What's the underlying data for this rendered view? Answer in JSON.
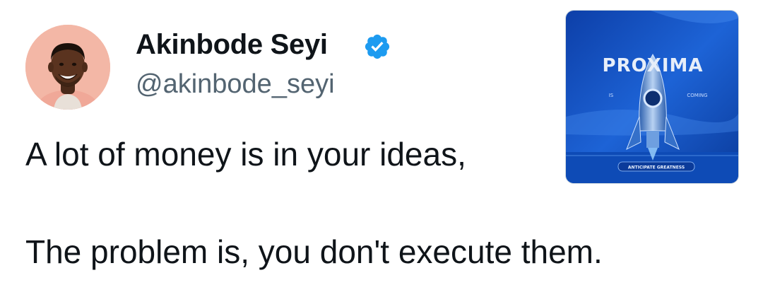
{
  "author": {
    "display_name": "Akinbode Seyi",
    "handle": "@akinbode_seyi",
    "verified": true,
    "avatar_icon": "profile-photo"
  },
  "tweet": {
    "line1": "A lot of money is in your ideas,",
    "line2": "The problem is, you don't execute them."
  },
  "media": {
    "brand": "PROXIMA",
    "tagline": "ANTICIPATE GREATNESS",
    "left_fragment": "IS",
    "right_fragment": "COMING",
    "icon": "rocket-icon"
  },
  "colors": {
    "verified_badge": "#1d9bf0",
    "handle": "#536471",
    "text": "#0f1419",
    "media_bg": "#1557c4"
  }
}
